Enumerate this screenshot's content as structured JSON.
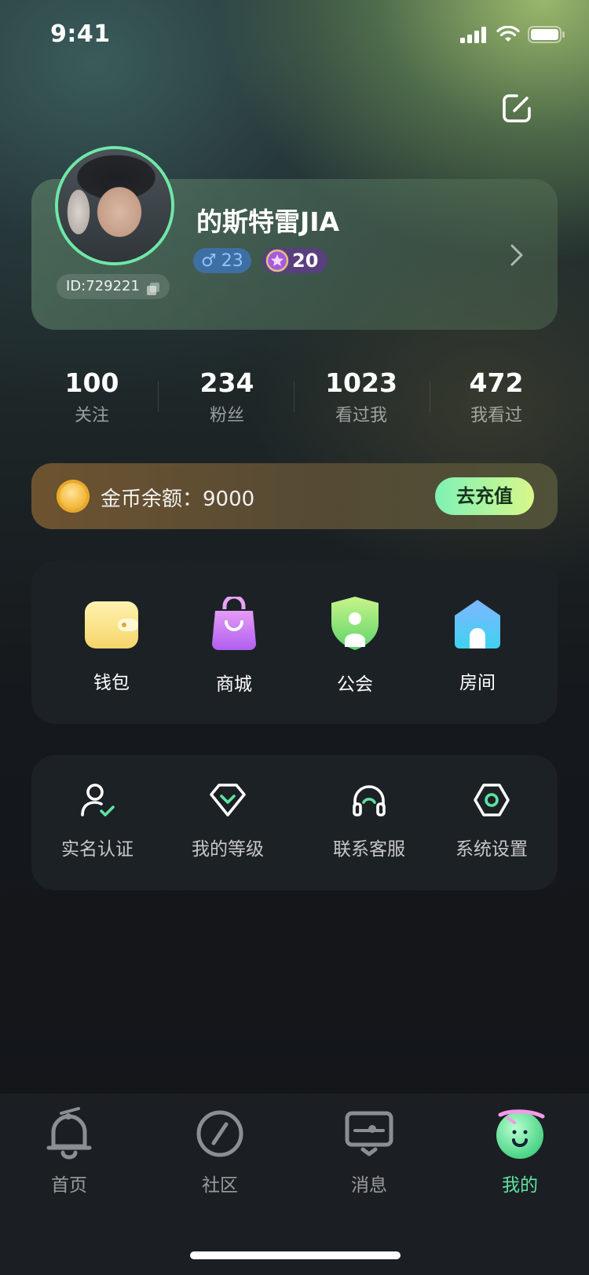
{
  "status_bar": {
    "time": "9:41"
  },
  "profile": {
    "username": "的斯特雷JIA",
    "id_text": "ID:729221",
    "gender_symbol": "♂",
    "age": "23",
    "level": "20"
  },
  "stats": [
    {
      "value": "100",
      "label": "关注"
    },
    {
      "value": "234",
      "label": "粉丝"
    },
    {
      "value": "1023",
      "label": "看过我"
    },
    {
      "value": "472",
      "label": "我看过"
    }
  ],
  "coins": {
    "label": "金币余额：9000",
    "recharge_label": "去充值"
  },
  "features": [
    {
      "label": "钱包",
      "icon": "wallet-icon"
    },
    {
      "label": "商城",
      "icon": "shopping-bag-icon"
    },
    {
      "label": "公会",
      "icon": "guild-shield-icon"
    },
    {
      "label": "房间",
      "icon": "house-icon"
    }
  ],
  "tools": [
    {
      "label": "实名认证",
      "icon": "user-verified-icon"
    },
    {
      "label": "我的等级",
      "icon": "diamond-level-icon"
    },
    {
      "label": "联系客服",
      "icon": "headset-icon"
    },
    {
      "label": "系统设置",
      "icon": "hex-settings-icon"
    }
  ],
  "tabs": [
    {
      "label": "首页",
      "icon": "bell-home-icon",
      "active": false
    },
    {
      "label": "社区",
      "icon": "compass-icon",
      "active": false
    },
    {
      "label": "消息",
      "icon": "message-icon",
      "active": false
    },
    {
      "label": "我的",
      "icon": "mine-face-icon",
      "active": true
    }
  ],
  "colors": {
    "accent": "#5fe3a0",
    "avatar_ring": "#6fe7a8",
    "panel": "#1c2126"
  }
}
